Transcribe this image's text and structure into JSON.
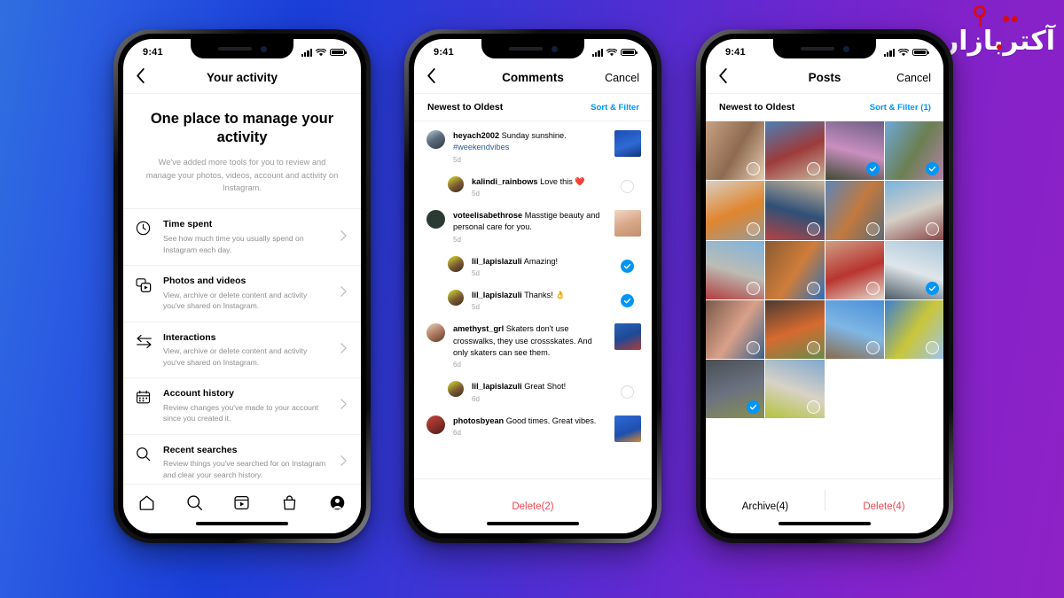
{
  "watermark": {
    "text": "آکتربازار"
  },
  "background": {
    "from": "#2f6fe0",
    "via": "#1a3ed8",
    "to": "#8e22c6"
  },
  "accent": {
    "blue": "#0095f6",
    "red": "#ed4956"
  },
  "phone1": {
    "status": {
      "time": "9:41"
    },
    "nav": {
      "title": "Your activity",
      "back_icon": "chevron-left-icon"
    },
    "hero": {
      "heading": "One place to manage your activity",
      "description": "We've added more tools for you to review and manage your photos, videos, account and activity on Instagram."
    },
    "items": [
      {
        "icon": "clock-icon",
        "title": "Time spent",
        "subtitle": "See how much time you usually spend on Instagram each day."
      },
      {
        "icon": "photos-videos-icon",
        "title": "Photos and videos",
        "subtitle": "View, archive or delete content and activity you've shared on Instagram."
      },
      {
        "icon": "interactions-arrows-icon",
        "title": "Interactions",
        "subtitle": "View, archive or delete content and activity you've shared on Instagram."
      },
      {
        "icon": "calendar-icon",
        "title": "Account history",
        "subtitle": "Review changes you've made to your account since you created it."
      },
      {
        "icon": "search-icon",
        "title": "Recent searches",
        "subtitle": "Review things you've searched for on Instagram and clear your search history."
      }
    ],
    "tabs": [
      {
        "name": "home",
        "icon": "home-icon"
      },
      {
        "name": "search",
        "icon": "search-icon"
      },
      {
        "name": "reels",
        "icon": "reels-icon"
      },
      {
        "name": "shop",
        "icon": "shop-bag-icon"
      },
      {
        "name": "profile",
        "icon": "profile-icon"
      }
    ]
  },
  "phone2": {
    "status": {
      "time": "9:41"
    },
    "nav": {
      "title": "Comments",
      "cancel": "Cancel",
      "back_icon": "chevron-left-icon"
    },
    "sort": {
      "label": "Newest to Oldest",
      "action": "Sort & Filter"
    },
    "comments": [
      {
        "user": "heyach2002",
        "text": " Sunday sunshine.",
        "tag": "#weekendvibes",
        "time": "5d",
        "reply": false,
        "right": "thumb",
        "thumb": "skateboard-blue"
      },
      {
        "user": "kalindi_rainbows",
        "text": " Love this ❤️",
        "time": "5d",
        "reply": true,
        "right": "circle",
        "selected": false
      },
      {
        "user": "voteelisabethrose",
        "text": " Masstige beauty and personal care for you.",
        "time": "5d",
        "reply": false,
        "right": "thumb",
        "thumb": "portrait-blonde"
      },
      {
        "user": "lil_lapislazuli",
        "text": " Amazing!",
        "time": "5d",
        "reply": true,
        "right": "circle",
        "selected": true
      },
      {
        "user": "lil_lapislazuli",
        "text": " Thanks! 👌",
        "time": "5d",
        "reply": true,
        "right": "circle",
        "selected": true
      },
      {
        "user": "amethyst_grl",
        "text": " Skaters don't use crosswalks, they use crossskates. And only skaters can see them.",
        "time": "6d",
        "reply": false,
        "right": "thumb",
        "thumb": "skater-red"
      },
      {
        "user": "lil_lapislazuli",
        "text": " Great Shot!",
        "time": "6d",
        "reply": true,
        "right": "circle",
        "selected": false
      },
      {
        "user": "photosbyean",
        "text": " Good times. Great vibes.",
        "time": "6d",
        "reply": false,
        "right": "thumb",
        "thumb": "two-people-sky"
      }
    ],
    "footer": {
      "delete": "Delete(2)"
    }
  },
  "phone3": {
    "status": {
      "time": "9:41"
    },
    "nav": {
      "title": "Posts",
      "cancel": "Cancel",
      "back_icon": "chevron-left-icon"
    },
    "sort": {
      "label": "Newest to Oldest",
      "action": "Sort & Filter (1)"
    },
    "grid": [
      {
        "id": "p1",
        "selected": false,
        "colors": [
          "#c8a183",
          "#8e6a50",
          "#e8cdb2"
        ]
      },
      {
        "id": "p2",
        "selected": false,
        "colors": [
          "#4b7fb5",
          "#9d3b3b",
          "#c7b49a"
        ]
      },
      {
        "id": "p3",
        "selected": true,
        "colors": [
          "#6d5f86",
          "#c98fc0",
          "#3f4a33"
        ]
      },
      {
        "id": "p4",
        "selected": true,
        "colors": [
          "#6fa8d8",
          "#6b7f52",
          "#b383a8"
        ]
      },
      {
        "id": "p5",
        "selected": false,
        "colors": [
          "#d8cfc2",
          "#e0852f",
          "#9a9a94"
        ]
      },
      {
        "id": "p6",
        "selected": false,
        "colors": [
          "#cbb79b",
          "#2f5078",
          "#b44343"
        ]
      },
      {
        "id": "p7",
        "selected": false,
        "colors": [
          "#5b86b8",
          "#c2793f",
          "#5e6b73"
        ]
      },
      {
        "id": "p8",
        "selected": false,
        "colors": [
          "#79b2dd",
          "#d4cfc6",
          "#8a4747"
        ]
      },
      {
        "id": "p9",
        "selected": false,
        "colors": [
          "#7fb3dd",
          "#bcbcb4",
          "#b23d3d"
        ]
      },
      {
        "id": "p10",
        "selected": false,
        "colors": [
          "#8a5a33",
          "#cf7d3a",
          "#2f6fb5"
        ]
      },
      {
        "id": "p11",
        "selected": false,
        "colors": [
          "#cf9f86",
          "#b8352f",
          "#e4d8cc"
        ]
      },
      {
        "id": "p12",
        "selected": true,
        "colors": [
          "#a9c6da",
          "#dfe6ea",
          "#4d5a66"
        ]
      },
      {
        "id": "p13",
        "selected": false,
        "colors": [
          "#7b5a4a",
          "#d9a089",
          "#3b5f86"
        ]
      },
      {
        "id": "p14",
        "selected": false,
        "colors": [
          "#4a3a33",
          "#d66a2f",
          "#6a8a4a"
        ]
      },
      {
        "id": "p15",
        "selected": false,
        "colors": [
          "#4a90d9",
          "#7fb6e4",
          "#8a6a4a"
        ]
      },
      {
        "id": "p16",
        "selected": false,
        "colors": [
          "#3c7fd0",
          "#c9c63a",
          "#9ec4e8"
        ]
      },
      {
        "id": "p17",
        "selected": true,
        "colors": [
          "#4a4f55",
          "#6b7280",
          "#8a9050"
        ]
      },
      {
        "id": "p18",
        "selected": false,
        "colors": [
          "#7fa8cf",
          "#d8d2c6",
          "#b3c33a"
        ]
      }
    ],
    "footer": {
      "archive": "Archive(4)",
      "delete": "Delete(4)"
    }
  }
}
